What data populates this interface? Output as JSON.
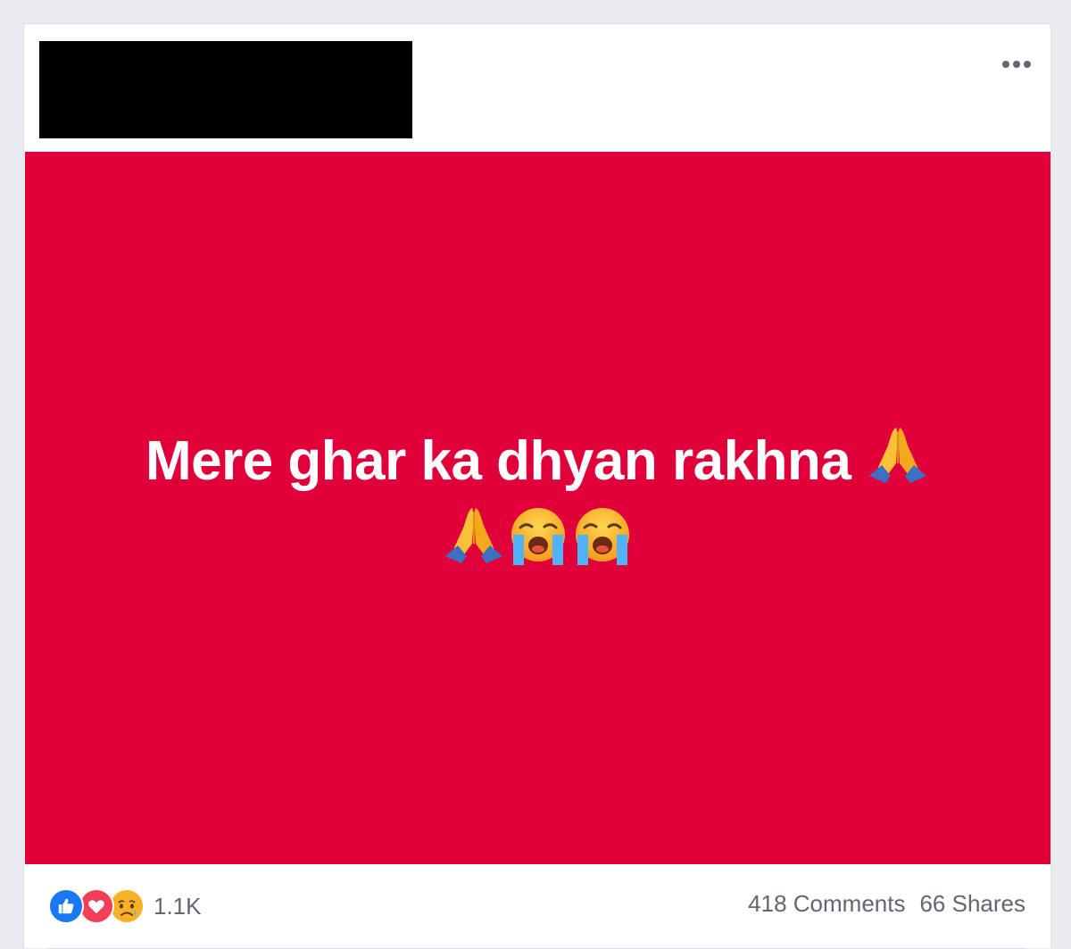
{
  "post": {
    "background_color": "#e0003a",
    "text": "Mere ghar ka dhyan rakhna",
    "emojis": [
      "folded-hands-icon",
      "folded-hands-icon",
      "loudly-crying-face-icon",
      "loudly-crying-face-icon"
    ]
  },
  "header": {
    "author_redacted": true,
    "more_icon": "more-options-icon"
  },
  "footer": {
    "reaction_icons": [
      "like-reaction-icon",
      "love-reaction-icon",
      "sad-reaction-icon"
    ],
    "reaction_count": "1.1K",
    "comments_label": "418 Comments",
    "shares_label": "66 Shares"
  },
  "colors": {
    "like": "#1877f2",
    "love": "#f33e58",
    "sad": "#f7b125"
  }
}
